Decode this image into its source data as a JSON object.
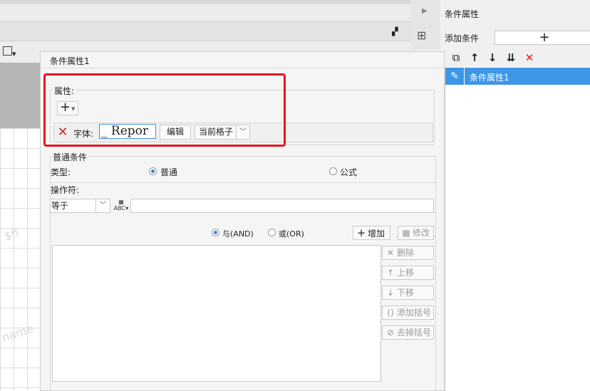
{
  "background": {
    "watermark_1": "$fi",
    "watermark_2": "name"
  },
  "right_panel": {
    "title": "条件属性",
    "add_condition_label": "添加条件",
    "add_condition_button": "+",
    "toolbar_icons": [
      "copy-icon",
      "arrow-up-icon",
      "arrow-down-icon",
      "move-bottom-icon",
      "close-icon"
    ],
    "items": [
      {
        "label": "条件属性1",
        "selected": true
      }
    ],
    "accent": "#3e96e6"
  },
  "dialog": {
    "title": "条件属性1",
    "property_group": {
      "label": "属性:",
      "add_button": "+",
      "row": {
        "delete_icon": "✕",
        "font_label": "字体:",
        "font_preview": "_ Repor",
        "edit_button": "编辑",
        "scope_value": "当前格子"
      }
    },
    "normal_condition": {
      "label": "普通条件",
      "type_label": "类型:",
      "type_normal": "普通",
      "type_formula": "公式",
      "type_selected": "普通",
      "operator_label": "操作符:",
      "operator_value": "等于",
      "operator_input": "",
      "and_label": "与(AND)",
      "or_label": "或(OR)",
      "logic_selected": "与(AND)",
      "add_button": "增加",
      "modify_button": "修改",
      "delete_button": "删除",
      "move_up_button": "上移",
      "move_down_button": "下移",
      "add_bracket_button": "添加括号",
      "remove_bracket_button": "去掉括号"
    }
  },
  "highlight_color": "#e8141e"
}
